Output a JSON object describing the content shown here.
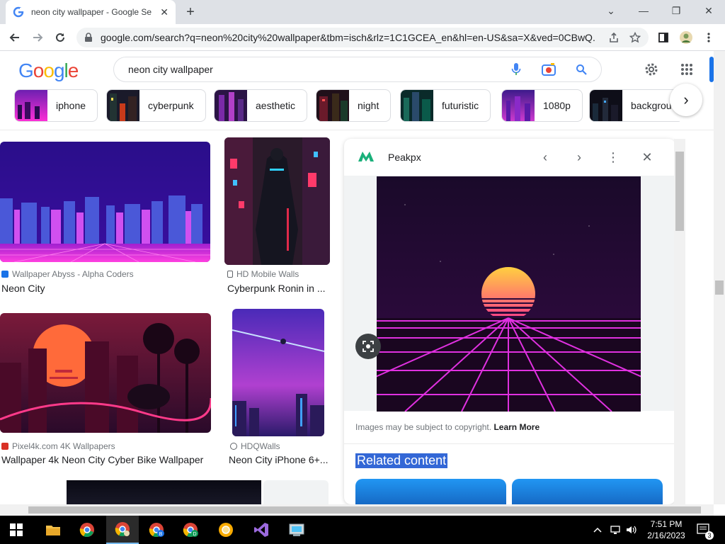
{
  "browser": {
    "tab_title": "neon city wallpaper - Google Se",
    "url": "google.com/search?q=neon%20city%20wallpaper&tbm=isch&rlz=1C1GCEA_en&hl=en-US&sa=X&ved=0CBwQ...",
    "new_tab": "+",
    "close_tab": "✕",
    "win_min": "—",
    "win_max": "❐",
    "win_close": "✕",
    "chevron": "⌄"
  },
  "search": {
    "logo_letters": [
      "G",
      "o",
      "o",
      "g",
      "l",
      "e"
    ],
    "logo_colors": [
      "#4285f4",
      "#ea4335",
      "#fbbc05",
      "#4285f4",
      "#34a853",
      "#ea4335"
    ],
    "query": "neon city wallpaper"
  },
  "chips": [
    {
      "label": "iphone"
    },
    {
      "label": "cyberpunk"
    },
    {
      "label": "aesthetic"
    },
    {
      "label": "night"
    },
    {
      "label": "futuristic"
    },
    {
      "label": "1080p"
    },
    {
      "label": "backgrou"
    }
  ],
  "chips_next": "›",
  "results": [
    {
      "source": "Wallpaper Abyss - Alpha Coders",
      "title": "Neon City"
    },
    {
      "source": "HD Mobile Walls",
      "title": "Cyberpunk Ronin in ..."
    },
    {
      "source": "Pixel4k.com 4K Wallpapers",
      "title": "Wallpaper 4k Neon City Cyber Bike Wallpaper"
    },
    {
      "source": "HDQWalls",
      "title": "Neon City iPhone 6+..."
    }
  ],
  "panel": {
    "site": "Peakpx",
    "prev": "‹",
    "next": "›",
    "more": "⋮",
    "close": "✕",
    "copyright": "Images may be subject to copyright.",
    "learn_more": "Learn More",
    "related": "Related content"
  },
  "taskbar": {
    "time": "7:51 PM",
    "date": "2/16/2023",
    "notifications": "3"
  },
  "colors": {
    "accent": "#1a73e8",
    "highlight": "#3367d6"
  }
}
